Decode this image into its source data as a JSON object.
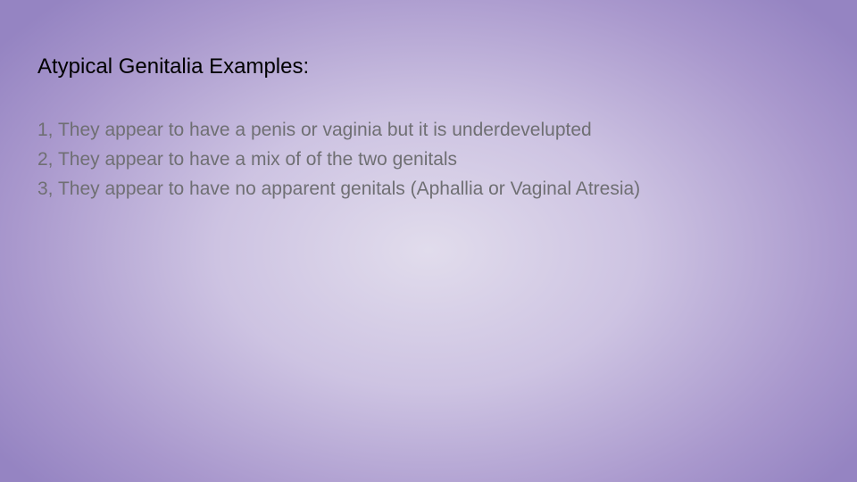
{
  "slide": {
    "title": "Atypical Genitalia Examples:",
    "items": [
      "1, They appear to have a penis or vaginia but it is underdevelupted",
      "2, They appear to have a mix of of the two genitals",
      "3, They appear to have no apparent genitals (Aphallia or Vaginal Atresia)"
    ]
  }
}
